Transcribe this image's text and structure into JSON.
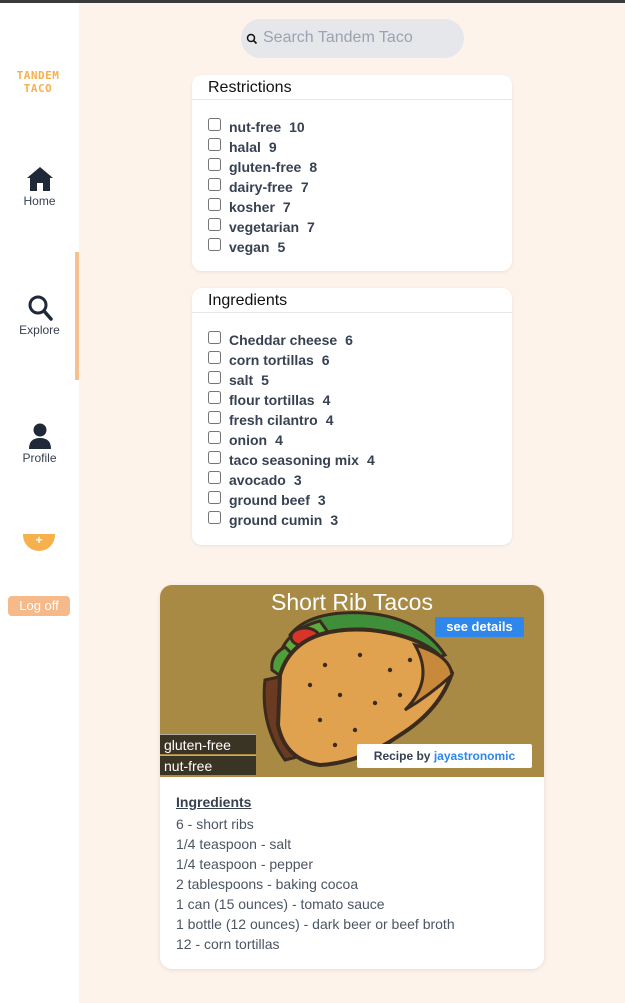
{
  "app": {
    "logo_line1": "TANDEM",
    "logo_line2": "TACO"
  },
  "sidebar": {
    "items": [
      {
        "label": "Home",
        "icon": "home-icon"
      },
      {
        "label": "Explore",
        "icon": "search-icon",
        "active": true
      },
      {
        "label": "Profile",
        "icon": "user-icon"
      }
    ],
    "add_label": "+",
    "logoff_label": "Log off"
  },
  "search": {
    "placeholder": "Search Tandem Taco",
    "value": ""
  },
  "filters": {
    "restrictions": {
      "title": "Restrictions",
      "options": [
        {
          "label": "nut-free",
          "count": "10",
          "checked": false
        },
        {
          "label": "halal",
          "count": "9",
          "checked": false
        },
        {
          "label": "gluten-free",
          "count": "8",
          "checked": false
        },
        {
          "label": "dairy-free",
          "count": "7",
          "checked": false
        },
        {
          "label": "kosher",
          "count": "7",
          "checked": false
        },
        {
          "label": "vegetarian",
          "count": "7",
          "checked": false
        },
        {
          "label": "vegan",
          "count": "5",
          "checked": false
        }
      ]
    },
    "ingredients": {
      "title": "Ingredients",
      "options": [
        {
          "label": "Cheddar cheese",
          "count": "6",
          "checked": false
        },
        {
          "label": "corn tortillas",
          "count": "6",
          "checked": false
        },
        {
          "label": "salt",
          "count": "5",
          "checked": false
        },
        {
          "label": "flour tortillas",
          "count": "4",
          "checked": false
        },
        {
          "label": "fresh cilantro",
          "count": "4",
          "checked": false
        },
        {
          "label": "onion",
          "count": "4",
          "checked": false
        },
        {
          "label": "taco seasoning mix",
          "count": "4",
          "checked": false
        },
        {
          "label": "avocado",
          "count": "3",
          "checked": false
        },
        {
          "label": "ground beef",
          "count": "3",
          "checked": false
        },
        {
          "label": "ground cumin",
          "count": "3",
          "checked": false
        }
      ]
    }
  },
  "recipe": {
    "title": "Short Rib Tacos",
    "details_label": "see details",
    "tags": [
      "gluten-free",
      "nut-free"
    ],
    "author_prefix": "Recipe by",
    "author": "jayastronomic",
    "ingredients_heading": "Ingredients",
    "ingredients": [
      "6 - short ribs",
      "1/4 teaspoon - salt",
      "1/4 teaspoon - pepper",
      "2 tablespoons - baking cocoa",
      "1 can (15 ounces) - tomato sauce",
      "1 bottle (12 ounces) - dark beer or beef broth",
      "12 - corn tortillas"
    ]
  },
  "colors": {
    "accent": "#f6b04d",
    "link": "#2f86eb",
    "background": "#fdf3ea"
  }
}
